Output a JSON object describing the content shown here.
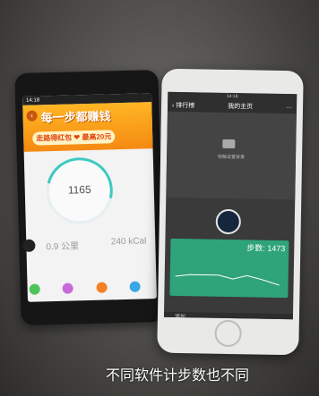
{
  "left_phone": {
    "status_time": "14:18",
    "banner_title": "每一步都赚钱",
    "banner_sub": "走路得红包 ❤ 最高20元",
    "steps": "1165",
    "metric_left": "0.9 公里",
    "metric_right": "240 kCal",
    "dot_colors": [
      "#4cc45a",
      "#c86ad9",
      "#f57f25",
      "#3aa6e6"
    ]
  },
  "right_phone": {
    "status_time": "14:18",
    "nav_back": "‹ 排行榜",
    "nav_title": "我的主页",
    "nav_more": "···",
    "cover_hint": "轻触设置背景",
    "steps_label": "步数: 1473",
    "add_row": "添加"
  },
  "caption": "不同软件计步数也不同"
}
